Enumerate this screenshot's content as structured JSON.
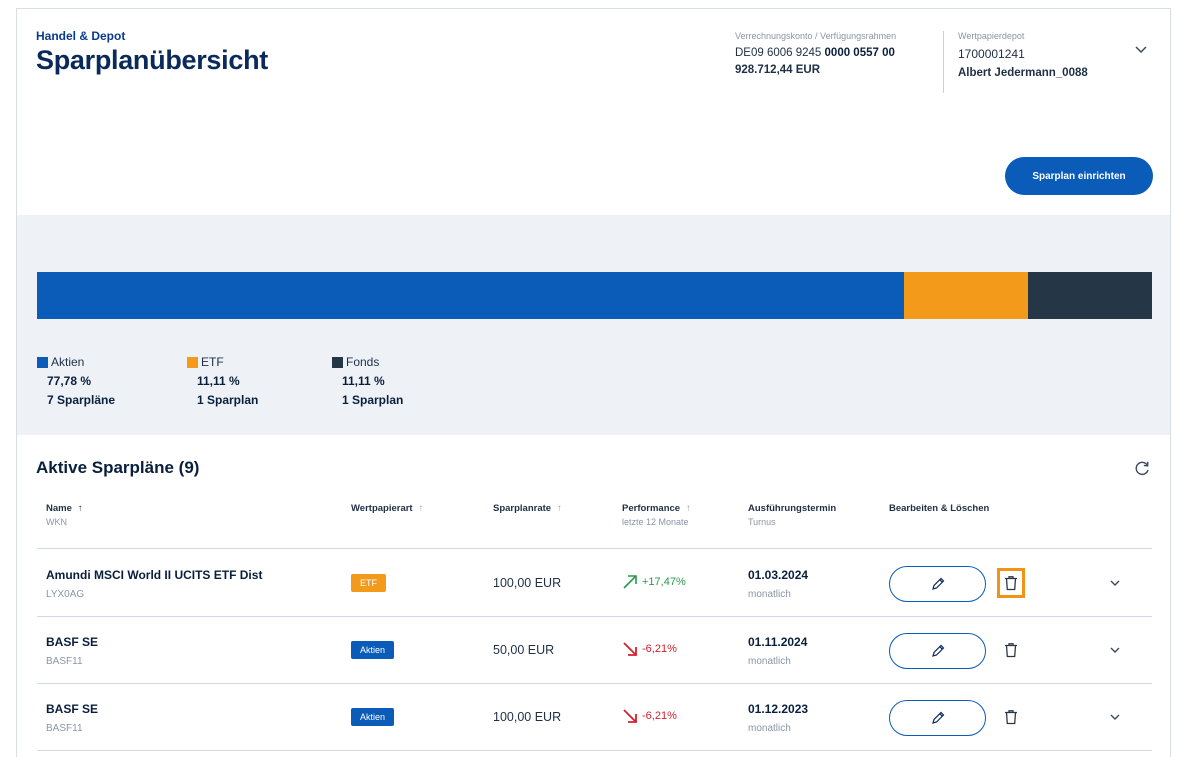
{
  "header": {
    "eyebrow": "Handel & Depot",
    "title": "Sparplanübersicht",
    "account_label": "Verrechnungskonto / Verfügungsrahmen",
    "iban_prefix": "DE09 6006 9245 ",
    "iban_bold": "0000 0557 00",
    "balance": "928.712,44 EUR",
    "depot_label": "Wertpapierdepot",
    "depot_number": "1700001241",
    "depot_owner": "Albert Jedermann_0088",
    "primary_button": "Sparplan einrichten"
  },
  "summary": {
    "segments": [
      {
        "name": "Aktien",
        "percent_value": 77.78,
        "color": "#0b5bb8"
      },
      {
        "name": "ETF",
        "percent_value": 11.11,
        "color": "#f39a1b"
      },
      {
        "name": "Fonds",
        "percent_value": 11.11,
        "color": "#253746"
      }
    ],
    "legend": [
      {
        "label": "Aktien",
        "percent": "77,78 %",
        "count": "7 Sparpläne"
      },
      {
        "label": "ETF",
        "percent": "11,11 %",
        "count": "1 Sparplan"
      },
      {
        "label": "Fonds",
        "percent": "11,11 %",
        "count": "1 Sparplan"
      }
    ]
  },
  "table": {
    "title": "Aktive Sparpläne (9)",
    "columns": [
      {
        "label": "Name",
        "sub": "WKN",
        "sort": "↑"
      },
      {
        "label": "Wertpapierart",
        "sub": "",
        "sort": "↑"
      },
      {
        "label": "Sparplanrate",
        "sub": "",
        "sort": "↑"
      },
      {
        "label": "Performance",
        "sub": "letzte 12 Monate",
        "sort": "↑"
      },
      {
        "label": "Ausführungstermin",
        "sub": "Turnus",
        "sort": ""
      },
      {
        "label": "Bearbeiten & Löschen",
        "sub": "",
        "sort": ""
      }
    ],
    "rows": [
      {
        "name": "Amundi MSCI World II UCITS ETF Dist",
        "wkn": "LYX0AG",
        "type": "ETF",
        "type_color": "#f39a1b",
        "rate": "100,00 EUR",
        "performance": "+17,47%",
        "trend": "up",
        "trend_color": "#2a9a4a",
        "date": "01.03.2024",
        "turnus": "monatlich",
        "highlighted_delete": true
      },
      {
        "name": "BASF SE",
        "wkn": "BASF11",
        "type": "Aktien",
        "type_color": "#0b5bb8",
        "rate": "50,00 EUR",
        "performance": "-6,21%",
        "trend": "down",
        "trend_color": "#d4202c",
        "date": "01.11.2024",
        "turnus": "monatlich",
        "highlighted_delete": false
      },
      {
        "name": "BASF SE",
        "wkn": "BASF11",
        "type": "Aktien",
        "type_color": "#0b5bb8",
        "rate": "100,00 EUR",
        "performance": "-6,21%",
        "trend": "down",
        "trend_color": "#d4202c",
        "date": "01.12.2023",
        "turnus": "monatlich",
        "highlighted_delete": false
      }
    ]
  },
  "colors": {
    "brand": "#0b5bb8",
    "highlight": "#f09317"
  }
}
